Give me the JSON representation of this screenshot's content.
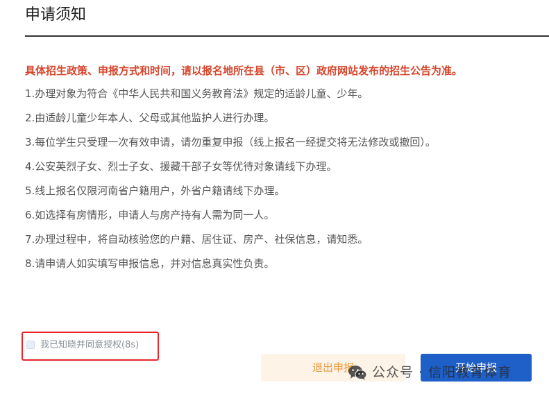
{
  "page": {
    "title": "申请须知"
  },
  "notice": {
    "text": "具体招生政策、申报方式和时间，请以报名地所在县（市、区）政府网站发布的招生公告为准。"
  },
  "items": [
    "1.办理对象为符合《中华人民共和国义务教育法》规定的适龄儿童、少年。",
    "2.由适龄儿童少年本人、父母或其他监护人进行办理。",
    "3.每位学生只受理一次有效申请，请勿重复申报（线上报名一经提交将无法修改或撤回）。",
    "4.公安英烈子女、烈士子女、援藏干部子女等优待对象请线下办理。",
    "5.线上报名仅限河南省户籍用户，外省户籍请线下办理。",
    "6.如选择有房情形，申请人与房产持有人需为同一人。",
    "7.办理过程中，将自动核验您的户籍、居住证、房产、社保信息，请知悉。",
    "8.请申请人如实填写申报信息，并对信息真实性负责。"
  ],
  "consent": {
    "label": "我已知晓并同意授权(8s)",
    "checked": false,
    "highlight_color": "#e8252b"
  },
  "buttons": {
    "exit_label": "退出申报",
    "start_label": "开始申报"
  },
  "watermark": {
    "text": "公众号 · 信阳教育体育",
    "icon": "wechat-icon"
  },
  "colors": {
    "notice": "#d6452b",
    "primary": "#1e5fc8",
    "exit_bg": "#fdf3e6",
    "exit_text": "#ea9a3f"
  }
}
